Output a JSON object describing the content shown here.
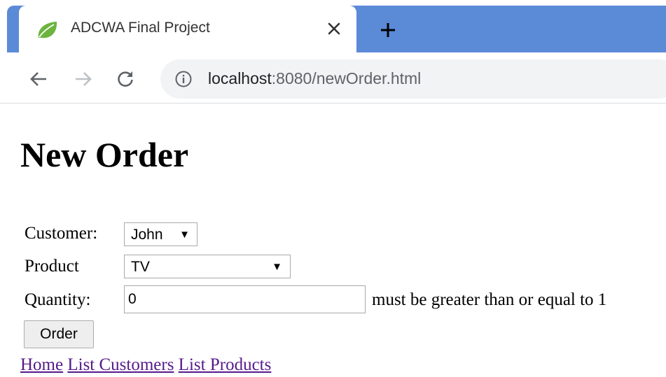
{
  "browser": {
    "tab": {
      "title": "ADCWA Final Project",
      "favicon": "spring-leaf-icon",
      "close_icon": "close-icon"
    },
    "new_tab_icon": "plus-icon",
    "nav": {
      "back_icon": "arrow-left-icon",
      "forward_icon": "arrow-right-icon",
      "reload_icon": "reload-icon"
    },
    "address_bar": {
      "info_icon": "info-icon",
      "url_host": "localhost",
      "url_path": ":8080/newOrder.html"
    },
    "colors": {
      "tabstrip": "#5b8ad7",
      "favicon": "#6db33f",
      "omnibox": "#f1f3f4"
    }
  },
  "page": {
    "title": "New Order",
    "form": {
      "customer_label": "Customer:",
      "customer_selected": "John",
      "product_label": "Product",
      "product_selected": "TV",
      "quantity_label": "Quantity:",
      "quantity_value": "0",
      "quantity_error": "must be greater than or equal to 1",
      "submit_label": "Order"
    },
    "links": [
      {
        "label": "Home"
      },
      {
        "label": "List Customers"
      },
      {
        "label": "List Products"
      }
    ],
    "colors": {
      "link_visited": "#551a8b"
    }
  }
}
